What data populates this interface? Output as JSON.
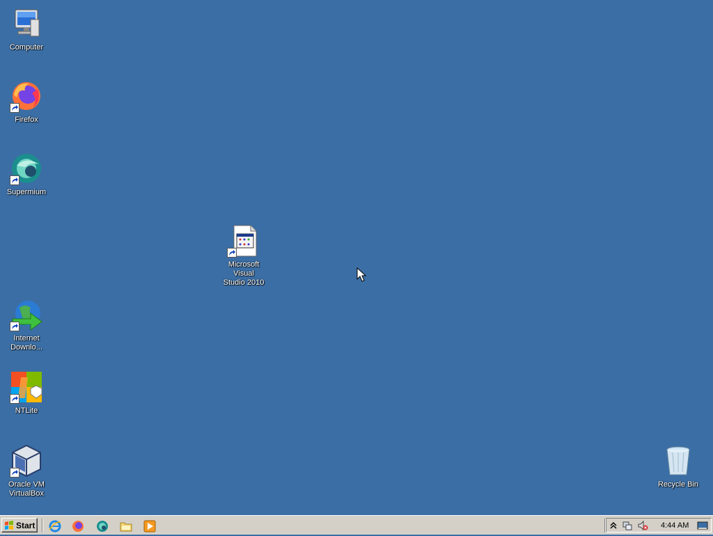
{
  "desktop": {
    "icons": {
      "computer": "Computer",
      "firefox": "Firefox",
      "supermium": "Supermium",
      "vs2010": "Microsoft Visual\nStudio 2010",
      "idm": "Internet\nDownlo...",
      "ntlite": "NTLite",
      "virtualbox": "Oracle VM\nVirtualBox",
      "recycle": "Recycle Bin"
    },
    "background_color": "#3b6ea5"
  },
  "taskbar": {
    "start_label": "Start",
    "quick_launch": [
      "internet-explorer-icon",
      "firefox-icon",
      "supermium-icon",
      "folder-icon",
      "media-player-icon"
    ],
    "tray": {
      "clock": "4:44 AM",
      "icons": [
        "show-hidden-icons-icon",
        "network-icon",
        "volume-muted-icon",
        "show-desktop-icon"
      ]
    }
  }
}
